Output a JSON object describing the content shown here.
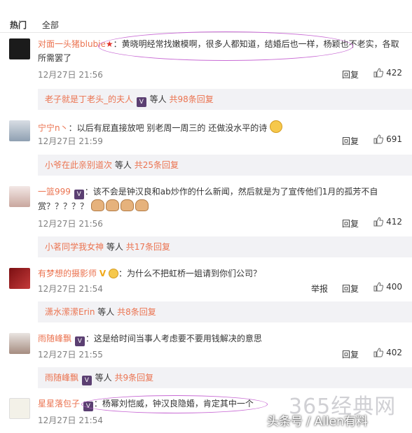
{
  "tabs": {
    "hot": "热门",
    "all": "全部"
  },
  "comments": [
    {
      "user": "对面一头猪blubie",
      "text": "：黄晓明经常找嫩模啊，很多人都知道，结婚后也一样，杨颖也不老实，各取所需罢了",
      "time": "12月27日 21:56",
      "reply": "回复",
      "likes": "422",
      "sub": {
        "user": "老子就是丁老头_的夫人",
        "mid": "等人",
        "count": "共98条回复"
      }
    },
    {
      "user": "宁宁n丶",
      "text": "：以后有屁直接放吧 别老周一周三的 还做没水平的诗",
      "time": "12月27日 21:59",
      "reply": "回复",
      "likes": "691",
      "sub": {
        "user": "小爷在此亲别道次",
        "mid": "等人",
        "count": "共25条回复"
      }
    },
    {
      "user": "一篮999",
      "text": "：该不会是钟汉良和ab炒作的什么新闻，然后就是为了宣传他们1月的孤芳不自赏？？？？？",
      "time": "12月27日 21:56",
      "reply": "回复",
      "likes": "412",
      "sub": {
        "user": "小茗同学我女神",
        "mid": "等人",
        "count": "共17条回复"
      }
    },
    {
      "user": "有梦想的摄影师",
      "text": "：为什么不把虹桥一姐请到你们公司？",
      "time": "12月27日 21:54",
      "report": "举报",
      "reply": "回复",
      "likes": "400",
      "sub": {
        "user": "潇水潆潆Erin",
        "mid": "等人",
        "count": "共8条回复"
      }
    },
    {
      "user": "雨随峰飘",
      "text": "：这是给时间当事人考虑要不要用钱解决的意思",
      "time": "12月27日 21:55",
      "reply": "回复",
      "likes": "402",
      "sub": {
        "user": "雨随峰飘",
        "mid": "等人",
        "count": "共9条回复"
      }
    },
    {
      "user": "星星落包子",
      "text": "：杨幂刘恺威，钟汉良隐婚，肯定其中一个",
      "time": "12月27日 21:54"
    }
  ],
  "watermark": {
    "line1": "365经典网",
    "line2": "头条号 / Allen有料"
  },
  "colors": {
    "username": "#eb7350",
    "oval": "#c86ad4",
    "reply_bg": "#f2f2f5"
  }
}
